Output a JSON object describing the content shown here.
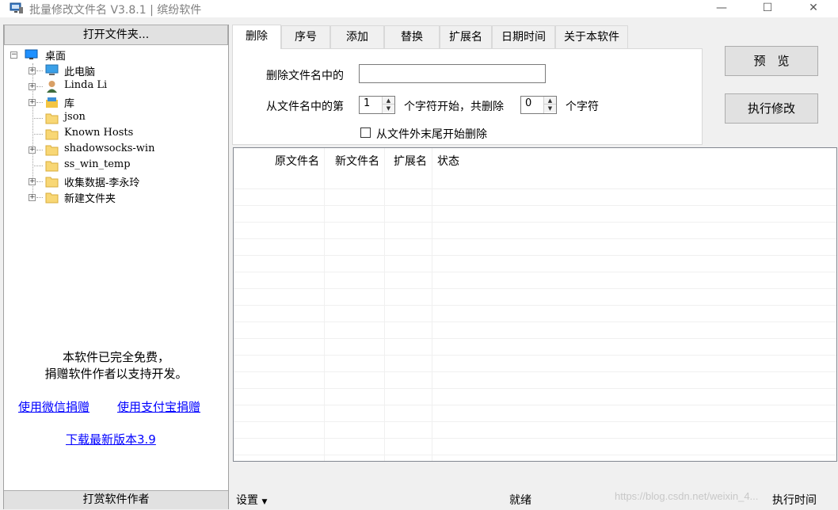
{
  "window": {
    "title": "批量修改文件名 V3.8.1 | 缤纷软件",
    "minimize": "—",
    "maximize": "☐",
    "close": "✕"
  },
  "left": {
    "open_folder": "打开文件夹...",
    "tree": [
      {
        "label": "桌面",
        "icon": "desktop-icon",
        "level": 0,
        "expander": "minus"
      },
      {
        "label": "此电脑",
        "icon": "computer-icon",
        "level": 1,
        "expander": "plus"
      },
      {
        "label": "Linda Li",
        "icon": "user-icon",
        "level": 1,
        "expander": "plus"
      },
      {
        "label": "库",
        "icon": "library-icon",
        "level": 1,
        "expander": "plus"
      },
      {
        "label": "json",
        "icon": "folder-icon",
        "level": 1,
        "expander": "none"
      },
      {
        "label": "Known Hosts",
        "icon": "folder-icon",
        "level": 1,
        "expander": "none"
      },
      {
        "label": "shadowsocks-win",
        "icon": "folder-icon",
        "level": 1,
        "expander": "plus"
      },
      {
        "label": "ss_win_temp",
        "icon": "folder-icon",
        "level": 1,
        "expander": "none"
      },
      {
        "label": "收集数据-李永玲",
        "icon": "folder-icon",
        "level": 1,
        "expander": "plus"
      },
      {
        "label": "新建文件夹",
        "icon": "folder-icon",
        "level": 1,
        "expander": "plus"
      }
    ],
    "free_line1": "本软件已完全免费，",
    "free_line2": "捐赠软件作者以支持开发。",
    "donate_wechat": "使用微信捐赠",
    "donate_alipay": "使用支付宝捐赠",
    "download_latest": "下载最新版本3.9",
    "reward_author": "打赏软件作者"
  },
  "tabs": [
    "删除",
    "序号",
    "添加",
    "替换",
    "扩展名",
    "日期时间",
    "关于本软件"
  ],
  "delete_tab": {
    "label_delete_in_name": "删除文件名中的",
    "delete_text_value": "",
    "label_from_nth": "从文件名中的第",
    "start_value": "1",
    "label_start_delete": "个字符开始，共删除",
    "count_value": "0",
    "label_chars": "个字符",
    "from_end_label": "从文件外末尾开始删除",
    "from_end_checked": false
  },
  "actions": {
    "preview": "预　览",
    "execute": "执行修改"
  },
  "list": {
    "columns": [
      "原文件名",
      "新文件名",
      "扩展名",
      "状态"
    ],
    "rows": []
  },
  "status": {
    "settings": "设置",
    "state": "就绪",
    "exec_time": "执行时间",
    "watermark": "https://blog.csdn.net/weixin_4..."
  }
}
